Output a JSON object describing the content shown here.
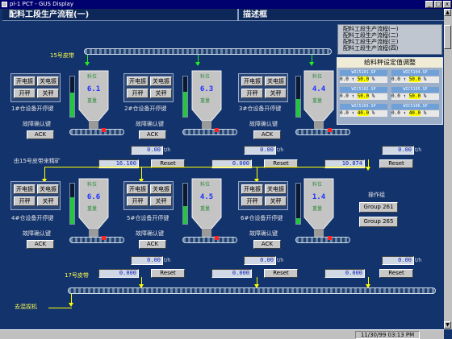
{
  "window": {
    "title": "pl-1 PCT - GUS Display"
  },
  "header": {
    "title": "配料工段生产流程(一)",
    "panel_title": "描述框"
  },
  "process_list": [
    "配料工段生产流程(一)",
    "配料工段生产流程(二)",
    "配料工段生产流程(三)",
    "配料工段生产流程(四)"
  ],
  "setpoint_panel": {
    "title": "给料秤设定值调整",
    "items": [
      {
        "label": "WIC5101.SP",
        "value": "50.0",
        "unit": "%"
      },
      {
        "label": "WIC5104.SP",
        "value": "50.0",
        "unit": "%"
      },
      {
        "label": "WIC5102.SP",
        "value": "50.0",
        "unit": "%"
      },
      {
        "label": "WIC5105.SP",
        "value": "50.0",
        "unit": "%"
      },
      {
        "label": "WIC5103.SP",
        "value": "40.0",
        "unit": "%"
      },
      {
        "label": "WIC5106.SP",
        "value": "40.0",
        "unit": "%"
      }
    ],
    "zero": "0.0"
  },
  "conveyors": {
    "c15": "15号皮带",
    "c15_ore": "由15号皮带来精矿",
    "c17": "17号皮带",
    "to_mixer": "去混捏机"
  },
  "units": [
    {
      "label": "1#仓设备开停键",
      "ack_prompt": "故障确认键",
      "level": "6.1",
      "flow": "0.00",
      "total": "16.100",
      "gauge_pct": 60
    },
    {
      "label": "2#仓设备开停键",
      "ack_prompt": "故障确认键",
      "level": "6.3",
      "flow": "0.00",
      "total": "0.000",
      "gauge_pct": 62
    },
    {
      "label": "3#仓设备开停键",
      "ack_prompt": "故障确认键",
      "level": "4.4",
      "flow": "0.00",
      "total": "10.874",
      "gauge_pct": 44
    },
    {
      "label": "4#仓设备开停键",
      "ack_prompt": "故障确认键",
      "level": "6.6",
      "flow": "0.00",
      "total": "0.000",
      "gauge_pct": 66
    },
    {
      "label": "5#仓设备开停键",
      "ack_prompt": "故障确认键",
      "level": "4.5",
      "flow": "0.00",
      "total": "0.000",
      "gauge_pct": 45
    },
    {
      "label": "6#仓设备开停键",
      "ack_prompt": "故障确认键",
      "level": "1.4",
      "flow": "0.00",
      "total": "0.000",
      "gauge_pct": 14
    }
  ],
  "controls": {
    "start_dist": "开电振",
    "stop_dist": "关电振",
    "start": "开秤",
    "stop": "关秤",
    "ack": "ACK",
    "reset": "Reset"
  },
  "silo": {
    "top_tag": "料位",
    "bottom_tag": "重量",
    "unit": "t/h"
  },
  "ops_group": {
    "title": "操作组",
    "btn1": "Group 261",
    "btn2": "Group 265"
  },
  "status": {
    "datetime": "11/30/99 03:13 PM"
  },
  "colors": {
    "background": "#13336d",
    "gauge_fill": "#24c640",
    "flow_arrow": "#ffff00",
    "motor_alarm": "#ff2222"
  }
}
